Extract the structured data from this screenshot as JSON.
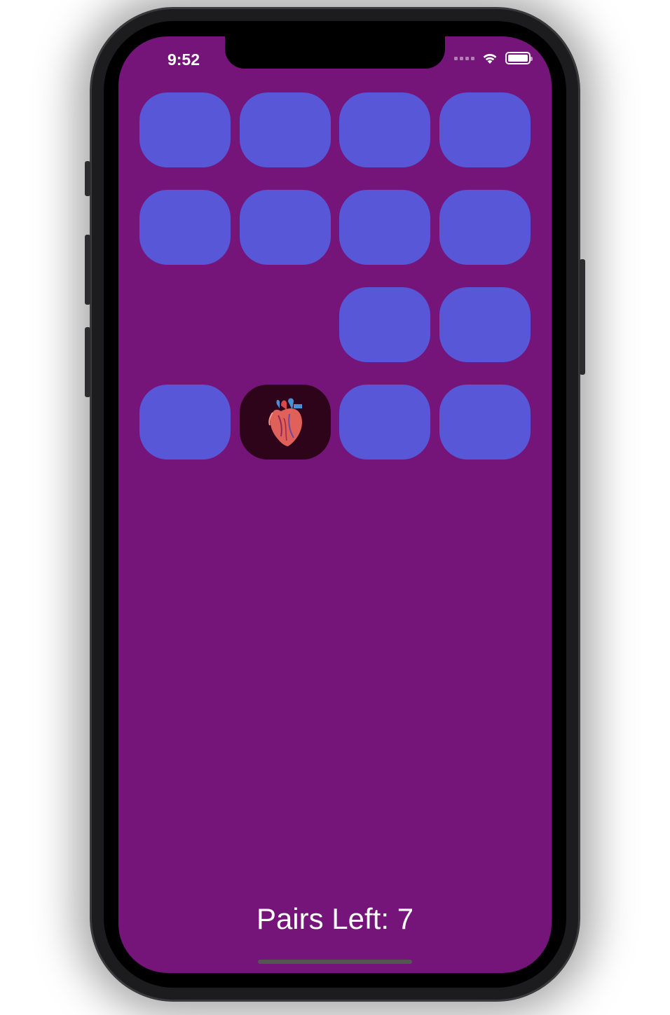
{
  "status_bar": {
    "time": "9:52",
    "signal_icon": "cellular-signal-icon",
    "wifi_icon": "wifi-icon",
    "battery_icon": "battery-icon"
  },
  "colors": {
    "background": "#75157a",
    "card_face_down": "#5757d7",
    "card_face_up": "#2d0419",
    "text": "#ffffff"
  },
  "board": {
    "rows": [
      [
        {
          "state": "down"
        },
        {
          "state": "down"
        },
        {
          "state": "down"
        },
        {
          "state": "down"
        }
      ],
      [
        {
          "state": "down"
        },
        {
          "state": "down"
        },
        {
          "state": "down"
        },
        {
          "state": "down"
        }
      ],
      [
        {
          "state": "matched"
        },
        {
          "state": "matched"
        },
        {
          "state": "down"
        },
        {
          "state": "down"
        }
      ],
      [
        {
          "state": "down"
        },
        {
          "state": "up",
          "icon": "anatomical-heart-icon"
        },
        {
          "state": "down"
        },
        {
          "state": "down"
        }
      ]
    ]
  },
  "footer": {
    "pairs_left_text": "Pairs Left: 7"
  }
}
